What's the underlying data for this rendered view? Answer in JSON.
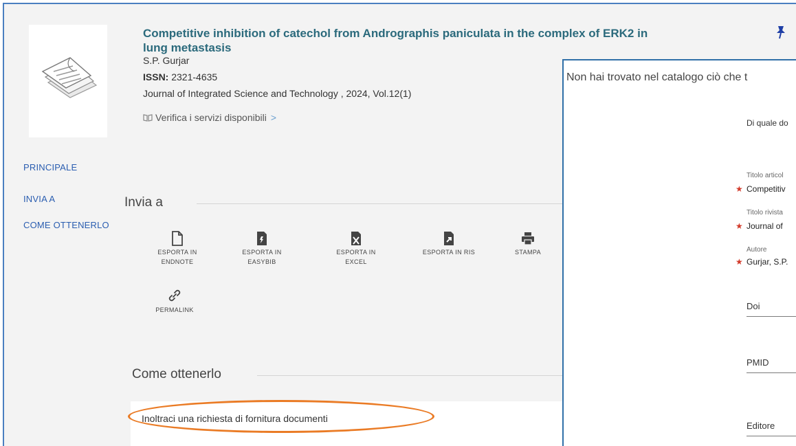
{
  "record": {
    "title": "Competitive inhibition of catechol from Andrographis paniculata in the complex of ERK2 in lung metastasis",
    "author": "S.P. Gurjar",
    "issn_label": "ISSN:",
    "issn_value": "2321-4635",
    "journal": "Journal of Integrated Science and Technology , 2024, Vol.12(1)",
    "services_label": "Verifica i servizi disponibili",
    "services_chevron": ">"
  },
  "nav": {
    "principale": "PRINCIPALE",
    "invia_a": "INVIA A",
    "come_ottenerlo": "COME OTTENERLO"
  },
  "send_section": {
    "heading": "Invia a",
    "tools": [
      {
        "line1": "ESPORTA IN",
        "line2": "ENDNOTE",
        "icon": "document-icon"
      },
      {
        "line1": "ESPORTA IN",
        "line2": "EASYBIB",
        "icon": "easybib-icon"
      },
      {
        "line1": "ESPORTA IN",
        "line2": "EXCEL",
        "icon": "excel-icon"
      },
      {
        "line1": "ESPORTA IN RIS",
        "line2": "",
        "icon": "ris-icon"
      },
      {
        "line1": "STAMPA",
        "line2": "",
        "icon": "print-icon"
      },
      {
        "line1": "PERMALINK",
        "line2": "",
        "icon": "link-icon"
      }
    ]
  },
  "obtain_section": {
    "heading": "Come ottenerlo",
    "request_text": "Inoltraci una richiesta di fornitura documenti"
  },
  "panel": {
    "header": "Non hai trovato nel catalogo ciò che t",
    "question": "Di quale do",
    "fields": [
      {
        "label": "Titolo articol",
        "value": "Competitiv",
        "required": true
      },
      {
        "label": "Titolo rivista",
        "value": "Journal of",
        "required": true
      },
      {
        "label": "Autore",
        "value": "Gurjar, S.P.",
        "required": true
      },
      {
        "label": "Doi",
        "value": "",
        "required": false
      },
      {
        "label": "PMID",
        "value": "",
        "required": false
      },
      {
        "label": "Editore",
        "value": "",
        "required": false
      }
    ],
    "required_mark": "★"
  },
  "colors": {
    "accent_title": "#2b6a7c",
    "nav_link": "#2a5db0",
    "highlight_oval": "#ea7b25",
    "panel_border": "#2f6fa8",
    "required_star": "#d23a2a"
  }
}
